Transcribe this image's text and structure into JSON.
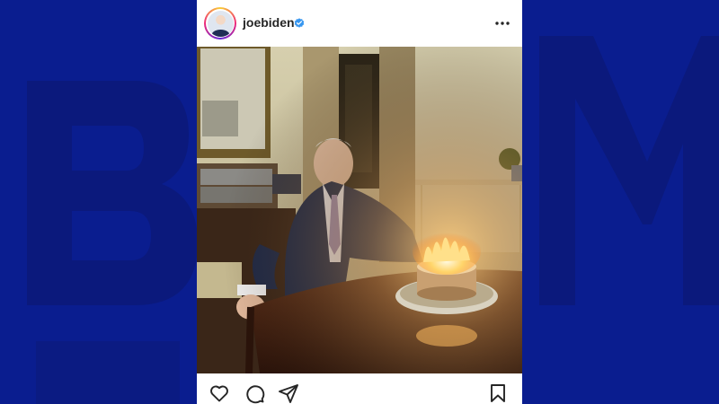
{
  "post": {
    "username": "joebiden",
    "avatar_icon": "profile-avatar",
    "verified_icon": "verified-badge-icon",
    "more_icon": "more-options-icon",
    "photo_description_icon": "birthday-cake-photo"
  },
  "actions": {
    "like_icon": "heart-icon",
    "comment_icon": "comment-icon",
    "share_icon": "send-icon",
    "save_icon": "bookmark-icon"
  },
  "colors": {
    "background": "#0a1d8f",
    "verified": "#3897f0",
    "text": "#262626"
  }
}
